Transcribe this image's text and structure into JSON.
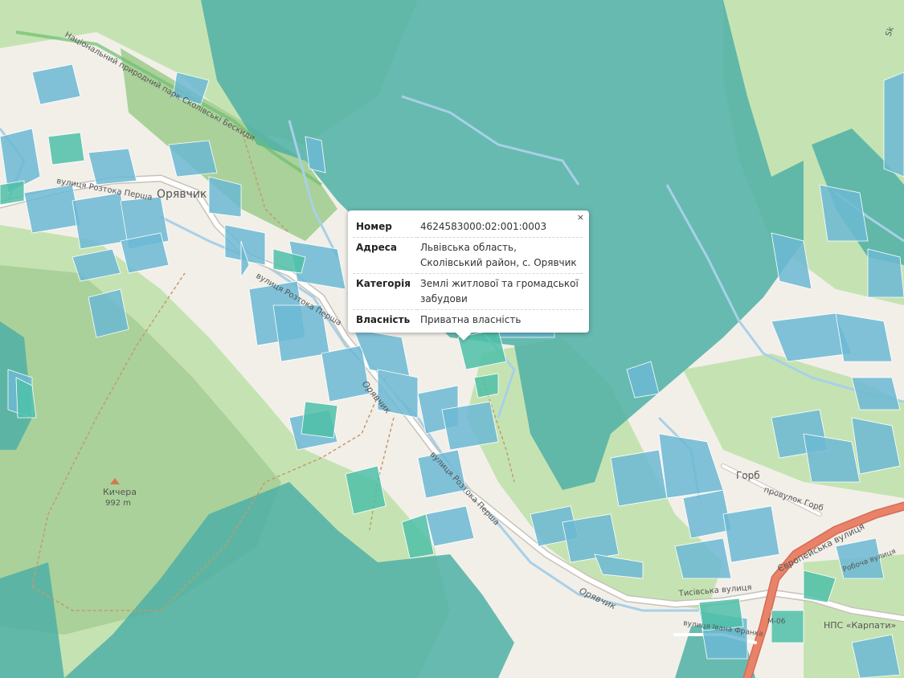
{
  "map_labels": {
    "village": "Орявчик",
    "street_1": "вулиця Розтока Перша",
    "street_2": "вулиця Розтока Перша",
    "street_3": "вулиця Розтока Перша",
    "river_1": "Орявчик",
    "river_2": "Орявчик",
    "park": "Національний природний парк Сколівські Бескиди",
    "peak_name": "Кичера",
    "peak_height": "992 m",
    "hamlet": "Горб",
    "lane": "провулок Горб",
    "highway": "Європейська вулиця",
    "street_tysiv": "Тисівська вулиця",
    "street_franka": "вулиця Івана Франка",
    "street_robocha": "Робоча вулиця",
    "road_code": "М-06",
    "nps": "НПС «Карпати»",
    "corner": "Sk"
  },
  "popup": {
    "close": "×",
    "rows": [
      {
        "key": "Номер",
        "value": "4624583000:02:001:0003"
      },
      {
        "key": "Адреса",
        "value": "Львівська область, Сколівський район, с. Орявчик"
      },
      {
        "key": "Категорія",
        "value": "Землі житлової та громадської забудови"
      },
      {
        "key": "Власність",
        "value": "Приватна власність"
      }
    ]
  },
  "colors": {
    "background": "#f2efe9",
    "forest": "#b6d9a6",
    "meadow": "#cde8bc",
    "forest_overlay": "#4fb0a6",
    "parcel_blue": "#6cb8d4",
    "parcel_teal": "#4fc0a8",
    "road_main": "#e8836a",
    "road_outline": "#c8c2b8",
    "river": "#a8d0e8"
  }
}
